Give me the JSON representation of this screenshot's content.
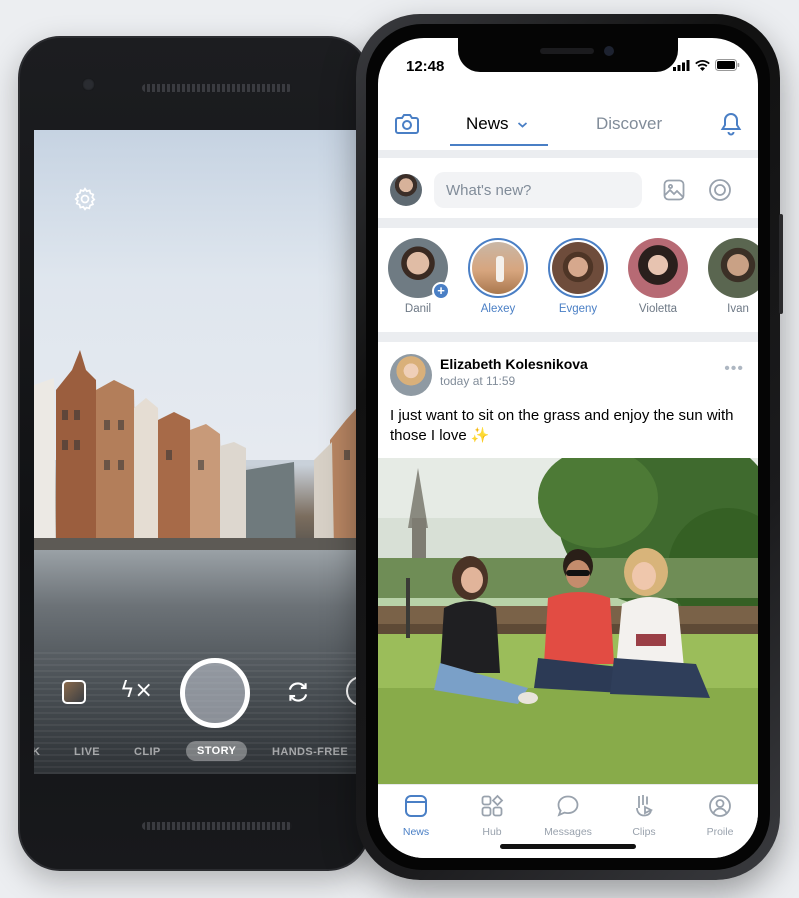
{
  "android_camera": {
    "modes": [
      "LIVE",
      "CLIP",
      "STORY",
      "HANDS-FREE"
    ],
    "active_mode": "STORY",
    "flash_label": "ϟ×",
    "icons": [
      "settings-icon",
      "gallery-icon",
      "flash-off-icon",
      "shutter-button",
      "flip-camera-icon"
    ]
  },
  "status_bar": {
    "time": "12:48"
  },
  "top_bar": {
    "tab_news": "News",
    "tab_discover": "Discover"
  },
  "composer": {
    "placeholder": "What's new?"
  },
  "stories": [
    {
      "name": "Danil",
      "highlight": false,
      "add": true
    },
    {
      "name": "Alexey",
      "highlight": true
    },
    {
      "name": "Evgeny",
      "highlight": true
    },
    {
      "name": "Violetta",
      "highlight": false
    },
    {
      "name": "Ivan",
      "highlight": false
    }
  ],
  "post": {
    "author": "Elizabeth Kolesnikova",
    "time": "today at 11:59",
    "text": "I just want to sit on the grass and enjoy the sun with those I love",
    "emoji": "✨",
    "more": "•••"
  },
  "bottom_nav": [
    {
      "label": "News",
      "active": true
    },
    {
      "label": "Hub",
      "active": false
    },
    {
      "label": "Messages",
      "active": false
    },
    {
      "label": "Clips",
      "active": false
    },
    {
      "label": "Proile",
      "active": false
    }
  ],
  "colors": {
    "accent": "#4a7fc5",
    "muted": "#818c99",
    "background": "#eceef1"
  }
}
